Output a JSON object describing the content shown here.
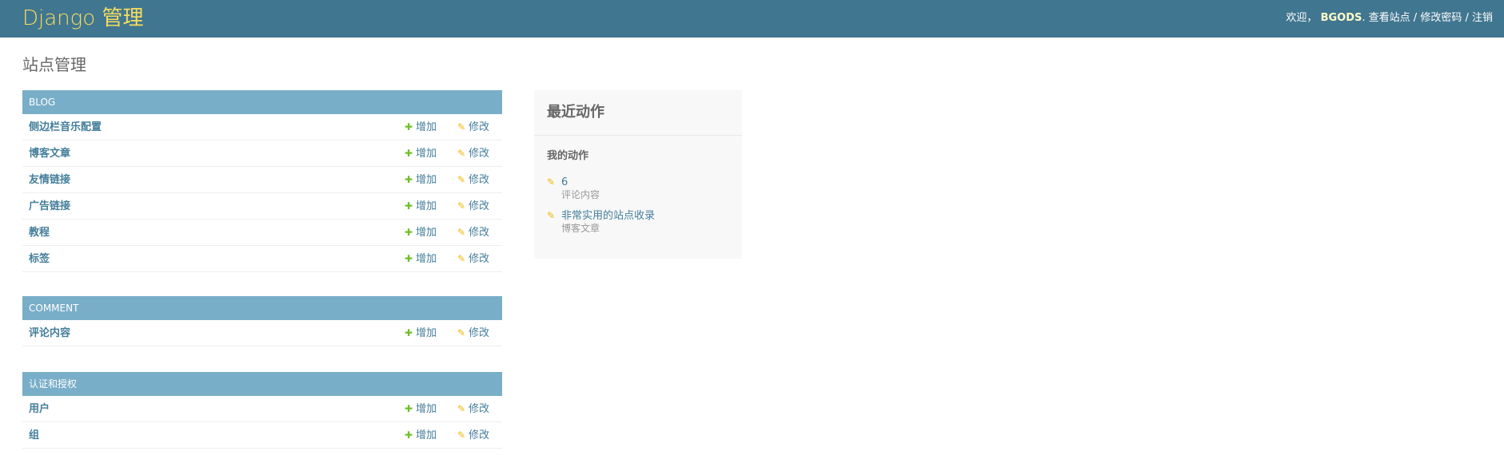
{
  "header": {
    "brand_name": "Django",
    "brand_title": "管理",
    "welcome": "欢迎，",
    "username": "BGODS",
    "period": ".",
    "view_site": "查看站点",
    "sep1": " / ",
    "change_password": "修改密码",
    "sep2": " / ",
    "logout": "注销"
  },
  "page": {
    "title": "站点管理"
  },
  "actions": {
    "add_label": "增加",
    "change_label": "修改"
  },
  "apps": [
    {
      "caption": "BLOG",
      "models": [
        "侧边栏音乐配置",
        "博客文章",
        "友情链接",
        "广告链接",
        "教程",
        "标签"
      ]
    },
    {
      "caption": "COMMENT",
      "models": [
        "评论内容"
      ]
    },
    {
      "caption": "认证和授权",
      "models": [
        "用户",
        "组"
      ]
    }
  ],
  "recent": {
    "title": "最近动作",
    "subtitle": "我的动作",
    "items": [
      {
        "name": "6",
        "type": "评论内容"
      },
      {
        "name": "非常实用的站点收录",
        "type": "博客文章"
      }
    ]
  },
  "colors": {
    "header_bg": "#417690",
    "brand": "#f5dd5d",
    "caption_bg": "#79aec8",
    "link": "#447e9b",
    "add_icon": "#70bf2b",
    "change_icon": "#efb80b"
  },
  "icons": {
    "add": "plus-icon",
    "change": "pencil-icon"
  }
}
